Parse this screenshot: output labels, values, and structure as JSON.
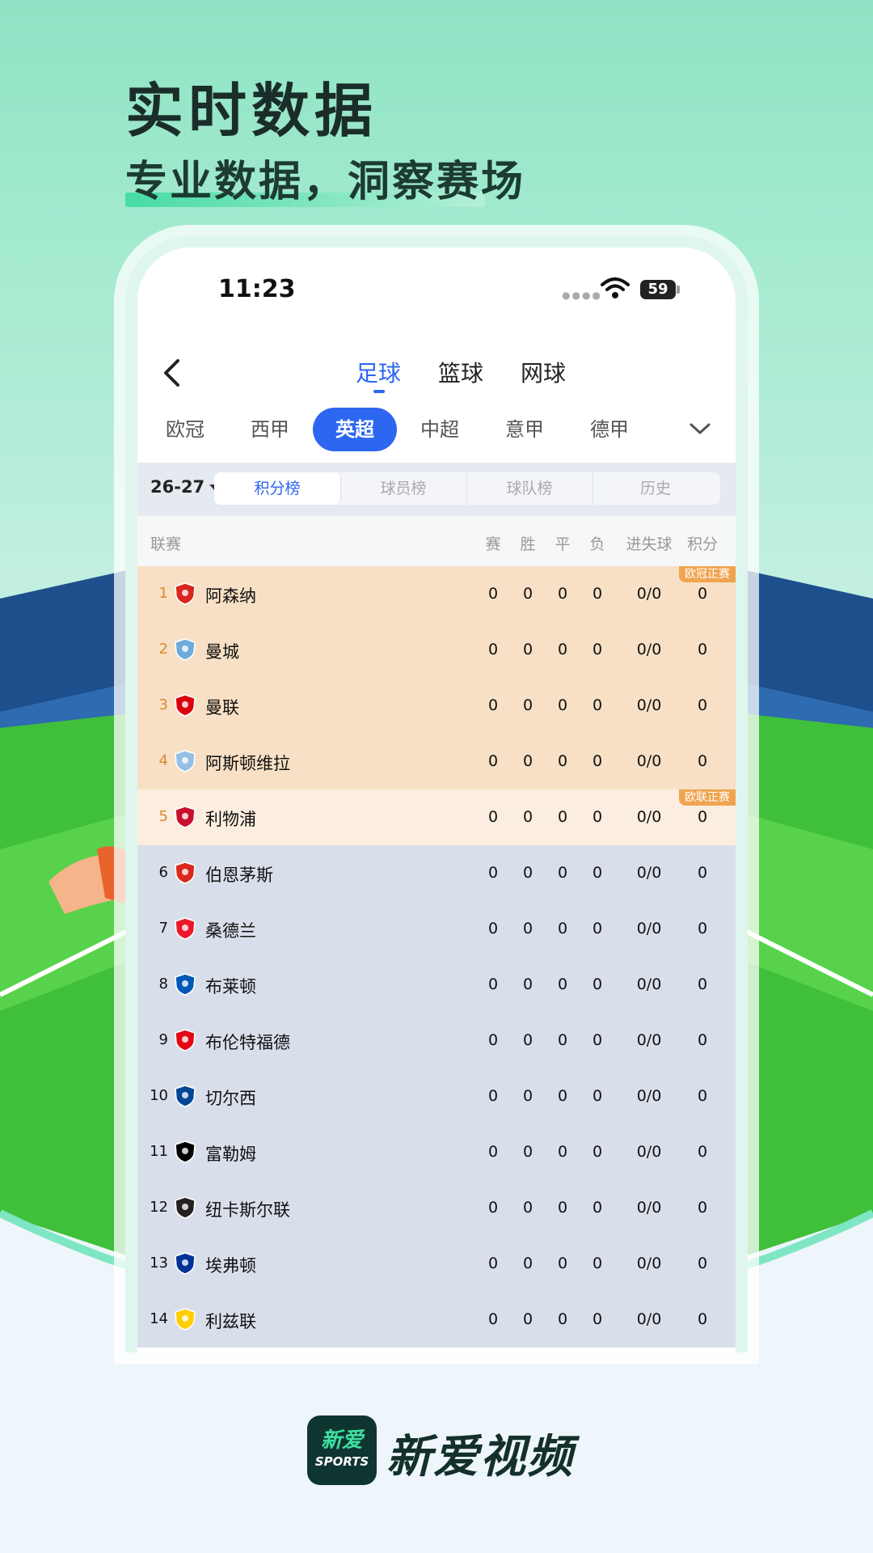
{
  "hero": {
    "title": "实时数据",
    "subtitle": "专业数据，洞察赛场"
  },
  "status_bar": {
    "time": "11:23",
    "battery": "59"
  },
  "sport_tabs": [
    {
      "label": "足球",
      "active": true
    },
    {
      "label": "篮球",
      "active": false
    },
    {
      "label": "网球",
      "active": false
    }
  ],
  "league_tabs": [
    {
      "label": "欧冠",
      "active": false
    },
    {
      "label": "西甲",
      "active": false
    },
    {
      "label": "英超",
      "active": true
    },
    {
      "label": "中超",
      "active": false
    },
    {
      "label": "意甲",
      "active": false
    },
    {
      "label": "德甲",
      "active": false
    }
  ],
  "season": "26-27",
  "segments": [
    {
      "label": "积分榜",
      "active": true
    },
    {
      "label": "球员榜",
      "active": false
    },
    {
      "label": "球队榜",
      "active": false
    },
    {
      "label": "历史",
      "active": false
    }
  ],
  "table_header": {
    "league": "联赛",
    "played": "赛",
    "won": "胜",
    "drawn": "平",
    "lost": "负",
    "goals": "进失球",
    "points": "积分"
  },
  "rows": [
    {
      "rank": "1",
      "team": "阿森纳",
      "played": "0",
      "won": "0",
      "drawn": "0",
      "lost": "0",
      "goals": "0/0",
      "points": "0",
      "zone": "ucl",
      "tag": "欧冠正赛"
    },
    {
      "rank": "2",
      "team": "曼城",
      "played": "0",
      "won": "0",
      "drawn": "0",
      "lost": "0",
      "goals": "0/0",
      "points": "0",
      "zone": "ucl"
    },
    {
      "rank": "3",
      "team": "曼联",
      "played": "0",
      "won": "0",
      "drawn": "0",
      "lost": "0",
      "goals": "0/0",
      "points": "0",
      "zone": "ucl"
    },
    {
      "rank": "4",
      "team": "阿斯顿维拉",
      "played": "0",
      "won": "0",
      "drawn": "0",
      "lost": "0",
      "goals": "0/0",
      "points": "0",
      "zone": "ucl"
    },
    {
      "rank": "5",
      "team": "利物浦",
      "played": "0",
      "won": "0",
      "drawn": "0",
      "lost": "0",
      "goals": "0/0",
      "points": "0",
      "zone": "uel",
      "tag": "欧联正赛"
    },
    {
      "rank": "6",
      "team": "伯恩茅斯",
      "played": "0",
      "won": "0",
      "drawn": "0",
      "lost": "0",
      "goals": "0/0",
      "points": "0",
      "zone": "none"
    },
    {
      "rank": "7",
      "team": "桑德兰",
      "played": "0",
      "won": "0",
      "drawn": "0",
      "lost": "0",
      "goals": "0/0",
      "points": "0",
      "zone": "none"
    },
    {
      "rank": "8",
      "team": "布莱顿",
      "played": "0",
      "won": "0",
      "drawn": "0",
      "lost": "0",
      "goals": "0/0",
      "points": "0",
      "zone": "none"
    },
    {
      "rank": "9",
      "team": "布伦特福德",
      "played": "0",
      "won": "0",
      "drawn": "0",
      "lost": "0",
      "goals": "0/0",
      "points": "0",
      "zone": "none"
    },
    {
      "rank": "10",
      "team": "切尔西",
      "played": "0",
      "won": "0",
      "drawn": "0",
      "lost": "0",
      "goals": "0/0",
      "points": "0",
      "zone": "none"
    },
    {
      "rank": "11",
      "team": "富勒姆",
      "played": "0",
      "won": "0",
      "drawn": "0",
      "lost": "0",
      "goals": "0/0",
      "points": "0",
      "zone": "none"
    },
    {
      "rank": "12",
      "team": "纽卡斯尔联",
      "played": "0",
      "won": "0",
      "drawn": "0",
      "lost": "0",
      "goals": "0/0",
      "points": "0",
      "zone": "none"
    },
    {
      "rank": "13",
      "team": "埃弗顿",
      "played": "0",
      "won": "0",
      "drawn": "0",
      "lost": "0",
      "goals": "0/0",
      "points": "0",
      "zone": "none"
    },
    {
      "rank": "14",
      "team": "利兹联",
      "played": "0",
      "won": "0",
      "drawn": "0",
      "lost": "0",
      "goals": "0/0",
      "points": "0",
      "zone": "none"
    }
  ],
  "crest_colors": [
    "#d9261c",
    "#6cabdd",
    "#da020e",
    "#95bfe5",
    "#c8102e",
    "#da291c",
    "#eb172b",
    "#0057b8",
    "#e30613",
    "#034694",
    "#000000",
    "#241f20",
    "#003399",
    "#ffcd00"
  ],
  "zone_colors": {
    "ucl": "#f7e0c5",
    "uel": "#fbeee0",
    "none": "#d9dfea"
  },
  "accent_color": "#2d66f0",
  "footer": {
    "logo_cn": "新爱",
    "logo_en": "SPORTS",
    "brand": "新爱视频"
  }
}
